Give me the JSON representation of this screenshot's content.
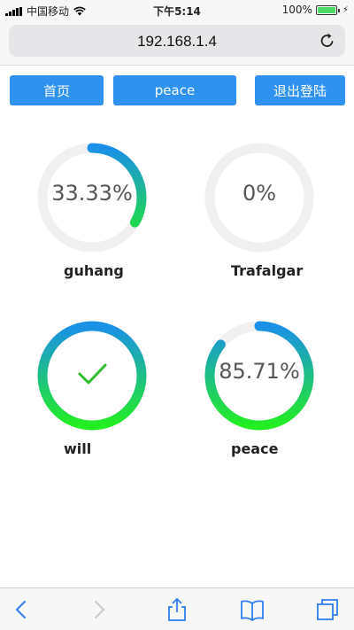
{
  "status_bar": {
    "carrier": "中国移动",
    "time": "下午5:14",
    "battery_percent": "100%",
    "battery_level": 1.0
  },
  "address_bar": {
    "url": "192.168.1.4"
  },
  "nav_buttons": {
    "home": "首页",
    "user": "peace",
    "logout": "退出登陆"
  },
  "progress_cards": [
    {
      "name": "guhang",
      "label": "33.33%",
      "percent": 33.33,
      "complete": false
    },
    {
      "name": "Trafalgar",
      "label": "0%",
      "percent": 0,
      "complete": false
    },
    {
      "name": "will",
      "label": "",
      "percent": 100,
      "complete": true
    },
    {
      "name": "peace",
      "label": "85.71%",
      "percent": 85.71,
      "complete": false
    }
  ],
  "colors": {
    "button": "#2f91f0",
    "gradient_start": "#22ee22",
    "gradient_end": "#1a90e8",
    "track": "#f0f0f0",
    "check": "#2dbd2d"
  }
}
